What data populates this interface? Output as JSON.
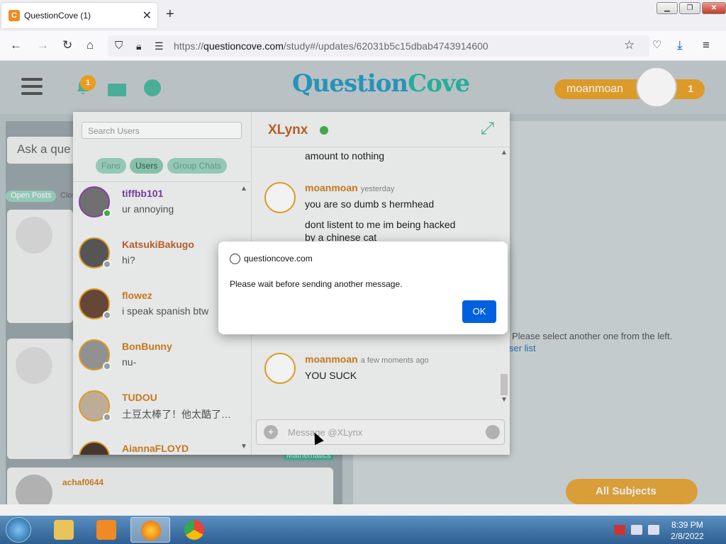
{
  "browser": {
    "tab_title": "QuestionCove (1)",
    "tab_favicon": "C",
    "url_domain": "questioncove.com",
    "url_path": "/study#/updates/62031b5c15dbab4743914600",
    "url_prefix": "https://"
  },
  "header": {
    "logo_text": "Question",
    "logo_text2": "Cove",
    "notification_count": "1",
    "username": "moanmoan",
    "user_count": "1"
  },
  "page": {
    "ask_placeholder": "Ask a que",
    "open_posts_label": "Open Posts",
    "closed_label": "Clos",
    "all_subjects": "All Subjects"
  },
  "chat": {
    "search_placeholder": "Search Users",
    "tabs": [
      {
        "label": "Fans"
      },
      {
        "label": "Users"
      },
      {
        "label": "Group Chats"
      }
    ],
    "users": [
      {
        "name": "tiffbb101",
        "message": "ur annoying",
        "online": true
      },
      {
        "name": "KatsukiBakugo",
        "message": "hi?",
        "online": false
      },
      {
        "name": "flowez",
        "message": "i speak spanish btw",
        "online": false
      },
      {
        "name": "BonBunny",
        "message": "nu-",
        "online": false
      },
      {
        "name": "TUDOU",
        "message": "土豆太棒了！他太酷了…",
        "online": false
      },
      {
        "name": "AiannaFLOYD",
        "message": "",
        "online": false
      }
    ],
    "conversation_name": "XLynx",
    "messages": [
      {
        "text": "amount to nothing"
      },
      {
        "author": "moanmoan",
        "time": "yesterday",
        "text": "you are so dumb s hermhead"
      },
      {
        "text": "dont listent to me im being hacked"
      },
      {
        "text": "by a chinese cat"
      },
      {
        "author": "moanmoan",
        "time": "a few moments ago",
        "text": "YOU SUCK"
      }
    ],
    "message_placeholder": "Message @XLynx"
  },
  "dialog": {
    "host": "questioncove.com",
    "message": "Please wait before sending another message.",
    "ok_label": "OK"
  },
  "background": {
    "select_text": "Please select another one from the left.",
    "user_list_link": "ser list",
    "subject_tag": "Mathematics",
    "card_user": "achaf0644"
  },
  "taskbar": {
    "time": "8:39 PM",
    "date": "2/8/2022"
  },
  "colors": {
    "accent": "#e8a32b",
    "teal": "#4cb8a0",
    "dialog_button": "#0061e0"
  }
}
